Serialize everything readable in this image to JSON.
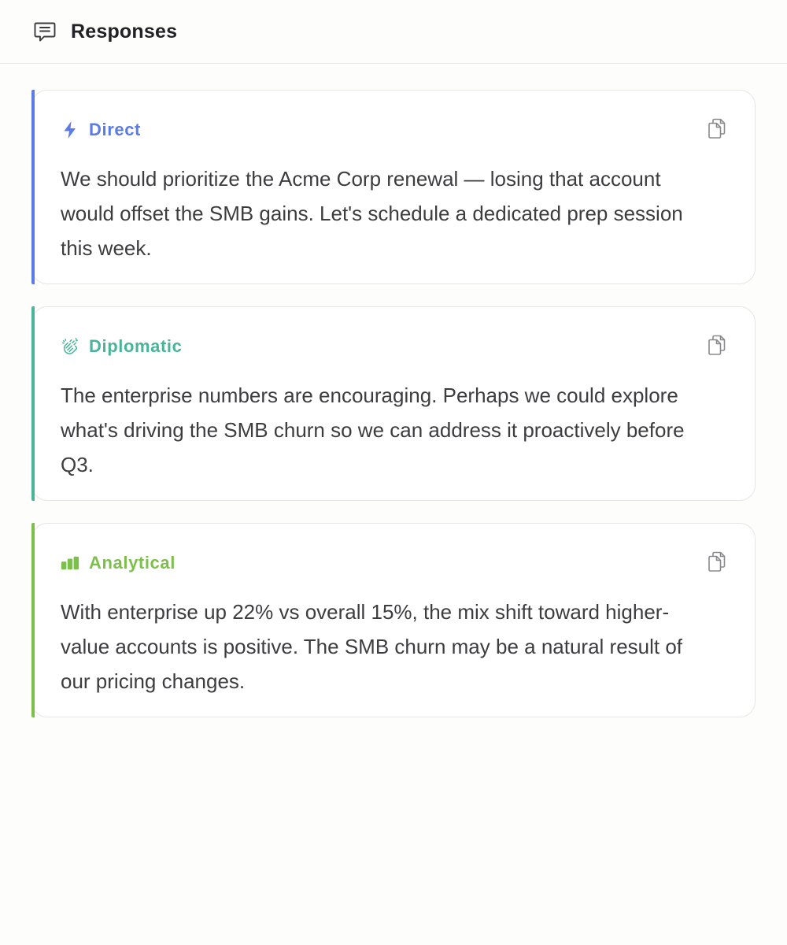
{
  "header": {
    "title": "Responses",
    "icon": "chat-bubble-icon"
  },
  "responses": [
    {
      "tone": "Direct",
      "icon": "lightning-bolt-icon",
      "accent": "#5b7ce6",
      "text": "We should prioritize the Acme Corp renewal — losing that account would offset the SMB gains. Let's schedule a dedicated prep session this week."
    },
    {
      "tone": "Diplomatic",
      "icon": "clapping-hands-icon",
      "accent": "#49b49a",
      "text": "The enterprise numbers are encouraging. Perhaps we could explore what's driving the SMB churn so we can address it proactively before Q3."
    },
    {
      "tone": "Analytical",
      "icon": "bar-chart-icon",
      "accent": "#7cc04b",
      "text": "With enterprise up 22% vs overall 15%, the mix shift toward higher-value accounts is positive. The SMB churn may be a natural result of our pricing changes."
    }
  ],
  "copy_icon": "copy-icon"
}
